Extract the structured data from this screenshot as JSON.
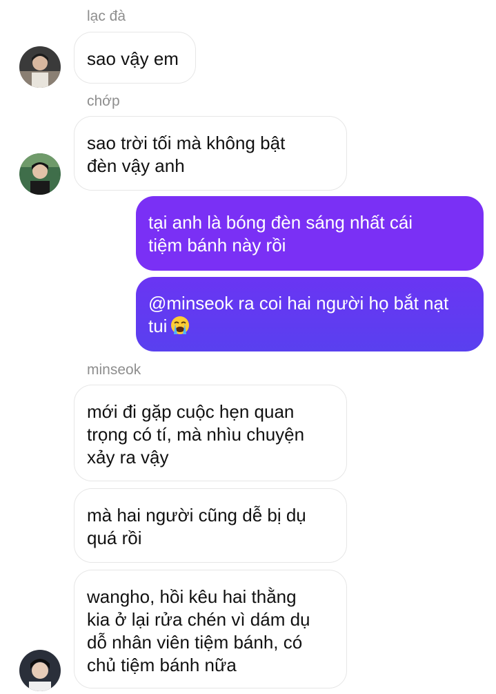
{
  "thread": {
    "group1": {
      "sender": "lạc đà",
      "lines": [
        "sao vậy em"
      ]
    },
    "group2": {
      "sender": "chớp",
      "lines": [
        "sao trời tối mà không bật",
        "đèn vậy anh"
      ]
    },
    "outgoing1": {
      "lines": [
        "tại anh là bóng đèn sáng nhất cái",
        "tiệm bánh này rồi"
      ]
    },
    "outgoing2": {
      "lines": [
        "@minseok ra coi hai người họ bắt nạt",
        "tui"
      ],
      "emoji": "loudly-crying-face-emoji"
    },
    "group3": {
      "sender": "minseok",
      "message1": [
        "mới đi gặp cuộc hẹn quan",
        "trọng có tí, mà nhìu chuyện",
        "xảy ra vậy"
      ],
      "message2": [
        "mà hai người cũng dễ bị dụ",
        "quá rồi"
      ],
      "message3": [
        "wangho, hồi kêu hai thằng",
        "kia ở lại rửa chén vì dám dụ",
        "dỗ nhân viên tiệm bánh, có",
        "chủ tiệm bánh nữa"
      ]
    }
  },
  "colors": {
    "outgoing_gradient_top": "#7b2ff7",
    "outgoing_gradient_bottom": "#5b3cf0",
    "incoming_border": "#e6e6e6",
    "sender_name": "#8e8e8e"
  }
}
